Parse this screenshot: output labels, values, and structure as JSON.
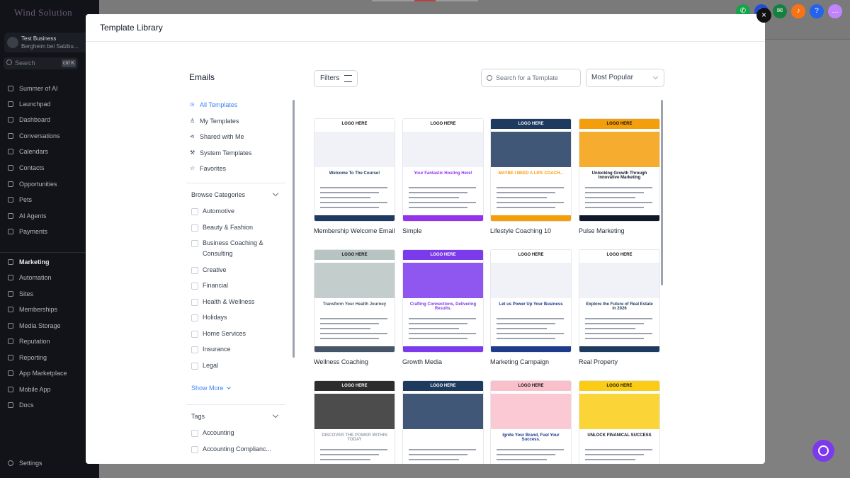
{
  "app": {
    "logo_text": "Wind Solution",
    "business_name": "Test Business",
    "business_location": "Bergheim bei Salzbu...",
    "search_placeholder": "Search",
    "search_shortcut": "ctrl K",
    "nav": [
      {
        "label": "Summer of AI",
        "icon": "sparkle-icon"
      },
      {
        "label": "Launchpad",
        "icon": "rocket-icon"
      },
      {
        "label": "Dashboard",
        "icon": "dashboard-icon"
      },
      {
        "label": "Conversations",
        "icon": "chat-icon"
      },
      {
        "label": "Calendars",
        "icon": "calendar-icon"
      },
      {
        "label": "Contacts",
        "icon": "contacts-icon"
      },
      {
        "label": "Opportunities",
        "icon": "funnel-icon"
      },
      {
        "label": "Pets",
        "icon": "paw-icon"
      },
      {
        "label": "AI Agents",
        "icon": "robot-icon"
      },
      {
        "label": "Payments",
        "icon": "payment-icon"
      },
      {
        "label": "Marketing",
        "icon": "send-icon",
        "active": true
      },
      {
        "label": "Automation",
        "icon": "automation-icon"
      },
      {
        "label": "Sites",
        "icon": "globe-icon"
      },
      {
        "label": "Memberships",
        "icon": "membership-icon"
      },
      {
        "label": "Media Storage",
        "icon": "image-icon"
      },
      {
        "label": "Reputation",
        "icon": "star-icon"
      },
      {
        "label": "Reporting",
        "icon": "chart-icon"
      },
      {
        "label": "App Marketplace",
        "icon": "grid-icon"
      },
      {
        "label": "Mobile App",
        "icon": "phone-icon"
      },
      {
        "label": "Docs",
        "icon": "info-icon"
      }
    ],
    "settings_label": "Settings",
    "top_icons": [
      {
        "name": "phone-icon",
        "color": "#16a34a",
        "glyph": "✆"
      },
      {
        "name": "megaphone-icon",
        "color": "#1d4ed8",
        "glyph": "◉"
      },
      {
        "name": "announcement-icon",
        "color": "#15803d",
        "glyph": "✉"
      },
      {
        "name": "bell-icon",
        "color": "#f97316",
        "glyph": "♪"
      },
      {
        "name": "help-icon",
        "color": "#2563eb",
        "glyph": "?"
      },
      {
        "name": "avatar-icon",
        "color": "#c084fc",
        "glyph": "…"
      }
    ]
  },
  "modal": {
    "title": "Template Library",
    "close_glyph": "×",
    "section_title": "Emails",
    "nav": [
      {
        "label": "All Templates",
        "glyph": "⊙",
        "active": true
      },
      {
        "label": "My Templates",
        "glyph": "♙"
      },
      {
        "label": "Shared with Me",
        "glyph": "⋖"
      },
      {
        "label": "System Templates",
        "glyph": "⚒"
      },
      {
        "label": "Favorites",
        "glyph": "☆"
      }
    ],
    "browse_categories_label": "Browse Categories",
    "categories": [
      "Automotive",
      "Beauty & Fashion",
      "Business Coaching &",
      "Consulting",
      "Creative",
      "Financial",
      "Health & Wellness",
      "Holidays",
      "Home Services",
      "Insurance",
      "Legal"
    ],
    "show_more_label": "Show More",
    "tags_label": "Tags",
    "tags": [
      "Accounting",
      "Accounting Complianc..."
    ],
    "filters_label": "Filters",
    "search_placeholder": "Search for a Template",
    "sort_value": "Most Popular"
  },
  "templates": [
    {
      "name": "Membership Welcome Email",
      "top_color": "#ffffff",
      "accent": "#1e3a5f",
      "headline": "Welcome To The Course!"
    },
    {
      "name": "Simple",
      "top_color": "#ffffff",
      "accent": "#9333ea",
      "headline": "Your Fantastic Hosting Here!"
    },
    {
      "name": "Lifestyle Coaching 10",
      "top_color": "#1e3a5f",
      "accent": "#f59e0b",
      "headline": "MAYBE I NEED A LIFE COACH..."
    },
    {
      "name": "Pulse Marketing",
      "top_color": "#f59e0b",
      "accent": "#111827",
      "headline": "Unlocking Growth Through Innovative Marketing"
    },
    {
      "name": "Wellness Coaching",
      "top_color": "#b8c4c2",
      "accent": "#475569",
      "headline": "Transform Your Health Journey"
    },
    {
      "name": "Growth Media",
      "top_color": "#7c3aed",
      "accent": "#7c3aed",
      "headline": "Crafting Connections, Delivering Results."
    },
    {
      "name": "Marketing Campaign",
      "top_color": "#ffffff",
      "accent": "#1e3a8a",
      "headline": "Let us Power Up Your Business"
    },
    {
      "name": "Real Property",
      "top_color": "#ffffff",
      "accent": "#1e3a5f",
      "headline": "Explore the Future of Real Estate in 2026"
    },
    {
      "name": "",
      "top_color": "#2d2d2d",
      "accent": "#9ca3af",
      "headline": "DISCOVER THE POWER WITHIN TODAY"
    },
    {
      "name": "",
      "top_color": "#1e3a5f",
      "accent": "#1e3a5f",
      "headline": ""
    },
    {
      "name": "",
      "top_color": "#f9c0cb",
      "accent": "#1e3a8a",
      "headline": "Ignite Your Brand, Fuel Your Success."
    },
    {
      "name": "",
      "top_color": "#facc15",
      "accent": "#111827",
      "headline": "UNLOCK FINANICAL SUCCESS"
    }
  ],
  "logo_here": "LOGO HERE"
}
